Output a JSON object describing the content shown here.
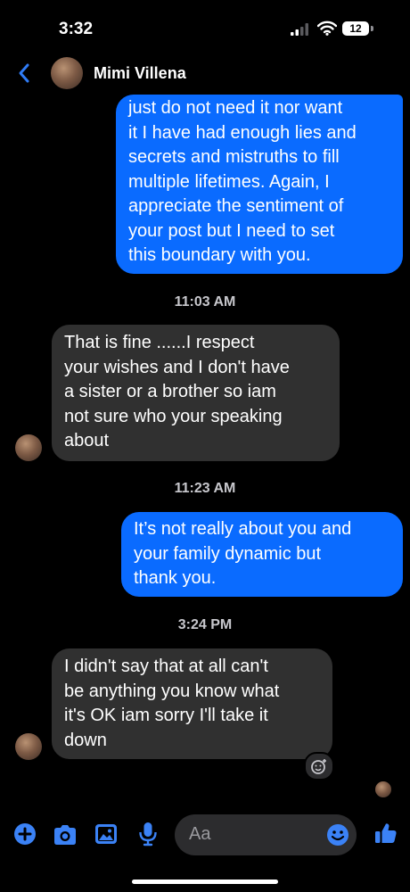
{
  "status_bar": {
    "time": "3:32",
    "battery": "12"
  },
  "header": {
    "contact_name": "Mimi Villena"
  },
  "messages": [
    {
      "direction": "outgoing",
      "lines": [
        "just do not need it nor want",
        "it I have had enough lies and",
        "secrets and mistruths to fill",
        "multiple lifetimes. Again, I",
        "appreciate the sentiment of",
        "your post but I need to set",
        "this boundary with you."
      ]
    },
    {
      "timestamp": "11:03 AM"
    },
    {
      "direction": "incoming",
      "lines": [
        "That is fine ......I respect",
        "your wishes and I don't have",
        "a sister or a brother so iam",
        "not sure who your speaking",
        "about"
      ]
    },
    {
      "timestamp": "11:23 AM"
    },
    {
      "direction": "outgoing",
      "lines": [
        "It’s not really about you and",
        "your family dynamic but",
        "thank you."
      ]
    },
    {
      "timestamp": "3:24 PM"
    },
    {
      "direction": "incoming",
      "lines": [
        "I didn't say that at all can't",
        "be anything you know what",
        "it's OK iam sorry I'll take it",
        "down"
      ]
    }
  ],
  "composer": {
    "placeholder": "Aa"
  },
  "colors": {
    "outgoing_bubble": "#0a6bff",
    "incoming_bubble": "#303030",
    "accent": "#3b82f6"
  },
  "icons": [
    "back-chevron-icon",
    "plus-circle-icon",
    "camera-icon",
    "image-icon",
    "microphone-icon",
    "emoji-icon",
    "thumbs-up-icon",
    "add-reaction-icon"
  ]
}
